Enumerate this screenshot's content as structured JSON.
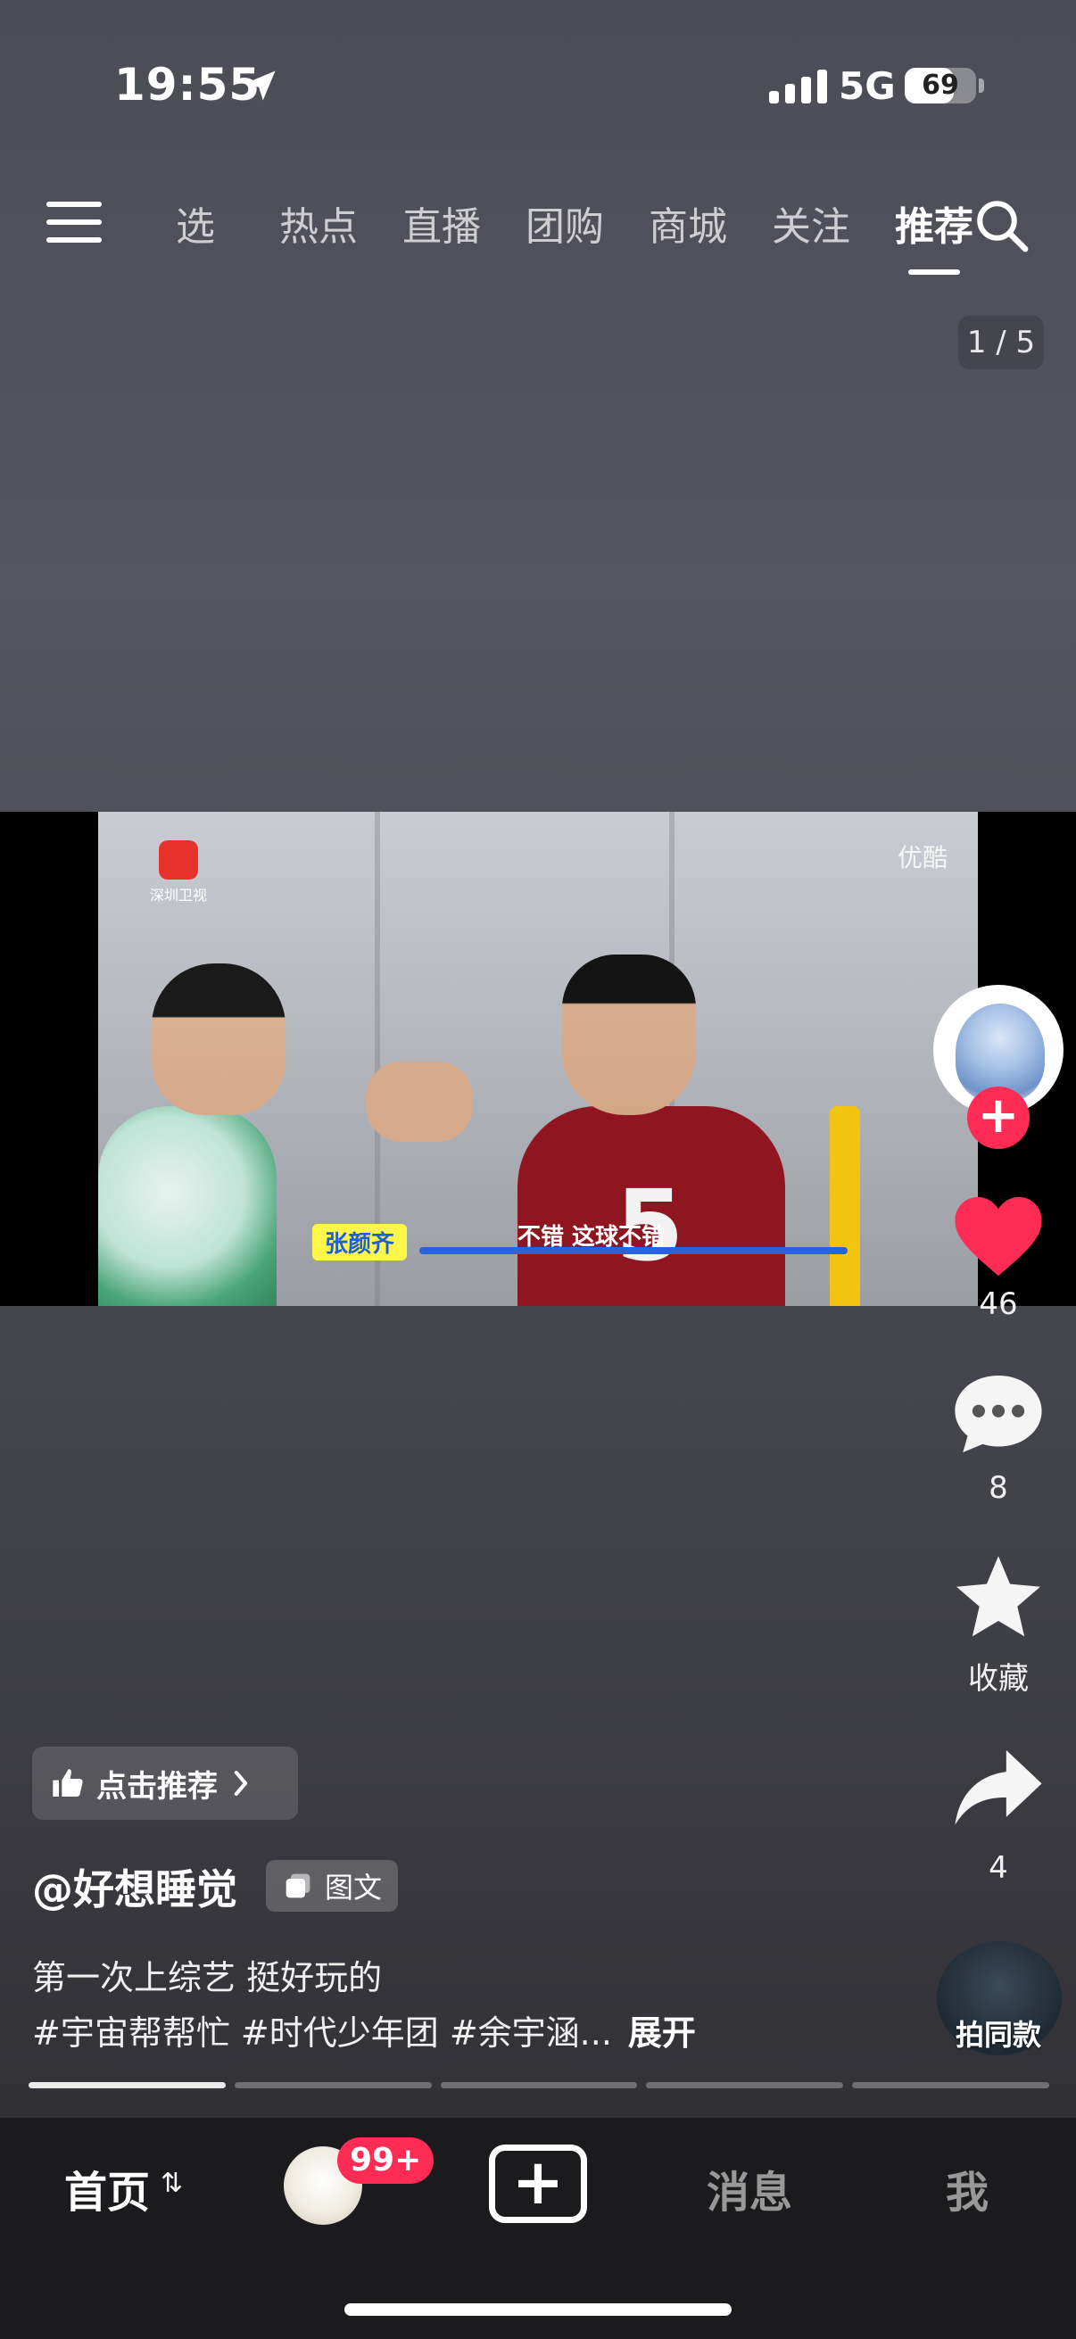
{
  "status_bar": {
    "time": "19:55",
    "network": "5G",
    "battery": "69",
    "battery_level": 0.69
  },
  "top_nav": {
    "tabs": [
      {
        "label": "选",
        "active": false
      },
      {
        "label": "热点",
        "active": false
      },
      {
        "label": "直播",
        "active": false
      },
      {
        "label": "团购",
        "active": false
      },
      {
        "label": "商城",
        "active": false
      },
      {
        "label": "关注",
        "active": false
      },
      {
        "label": "推荐",
        "active": true
      }
    ]
  },
  "page_indicator": "1 / 5",
  "media": {
    "channel_logo_text": "深圳卫视",
    "watermark": "优酷",
    "subtitle_name": "张颜齐",
    "subtitle_text": "不错 这球不错",
    "jersey_number": "5"
  },
  "actions": {
    "likes": "46",
    "comments": "8",
    "favorite_label": "收藏",
    "shares": "4",
    "follow_symbol": "+"
  },
  "post": {
    "recommend_label": "点击推荐",
    "author": "@好想睡觉",
    "type_chip": "图文",
    "caption": "第一次上综艺 挺好玩的",
    "hashtags": "#宇宙帮帮忙 #时代少年团 #余宇涵...",
    "expand_label": "展开",
    "same_style_label": "拍同款"
  },
  "image_progress": {
    "total": 5,
    "current": 1
  },
  "tab_bar": {
    "home": "首页",
    "badge": "99+",
    "add_symbol": "+",
    "messages": "消息",
    "me": "我"
  },
  "colors": {
    "accent": "#fe2c55",
    "tabbar_bg": "#1b1b1e"
  },
  "icons": [
    "location-arrow-icon",
    "signal-icon",
    "battery-icon",
    "menu-icon",
    "search-icon",
    "heart-icon",
    "comment-icon",
    "star-icon",
    "share-icon",
    "thumbs-up-icon",
    "chevron-right-icon",
    "image-text-icon",
    "swap-icon"
  ]
}
